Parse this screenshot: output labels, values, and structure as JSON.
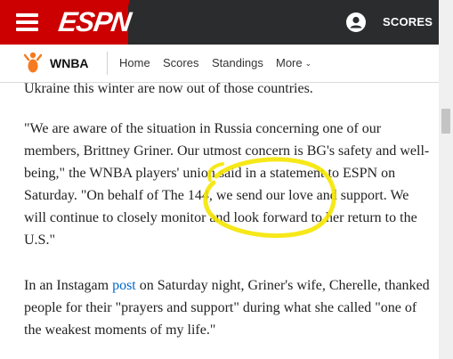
{
  "header": {
    "logo_text": "ESPN",
    "scores_label": "SCORES",
    "brand_color": "#cc0000",
    "dark_color": "#2b2c2d"
  },
  "subnav": {
    "league": "WNBA",
    "items": [
      {
        "label": "Home"
      },
      {
        "label": "Scores"
      },
      {
        "label": "Standings"
      },
      {
        "label": "More"
      }
    ]
  },
  "article": {
    "p0": "Ukraine this winter are now out of those countries.",
    "p1": "\"We are aware of the situation in Russia concerning one of our members, Brittney Griner. Our utmost concern is BG's safety and well-being,\" the WNBA players' union said in a statement to ESPN on Saturday. \"On behalf of The 144, we send our love and support. We will continue to closely monitor and look forward to her return to the U.S.\"",
    "p2_before": "In an Instagam ",
    "p2_link": "post",
    "p2_after": " on Saturday night, Griner's wife, Cherelle, thanked people for their \"prayers and support\" during what she called \"one of the weakest moments of my life.\"",
    "highlight_color": "#f5e600"
  }
}
